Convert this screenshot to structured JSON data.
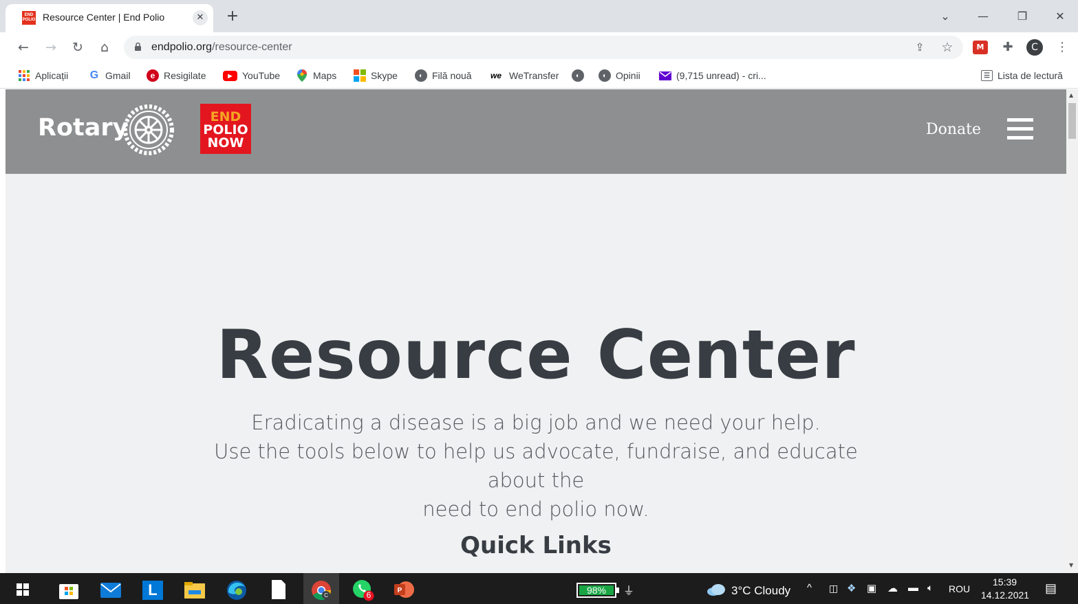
{
  "browser": {
    "tab_title": "Resource Center | End Polio",
    "tab_favicon_text": "END POLIO",
    "url_domain": "endpolio.org",
    "url_path": "/resource-center",
    "profile_initial": "C"
  },
  "bookmarks": [
    {
      "label": "Aplicații",
      "icon": "apps-grid-icon"
    },
    {
      "label": "Gmail",
      "icon": "google-icon"
    },
    {
      "label": "Resigilate",
      "icon": "emag-icon"
    },
    {
      "label": "YouTube",
      "icon": "youtube-icon"
    },
    {
      "label": "Maps",
      "icon": "maps-pin-icon"
    },
    {
      "label": "Skype",
      "icon": "windows-logo-icon"
    },
    {
      "label": "Filă nouă",
      "icon": "globe-icon"
    },
    {
      "label": "WeTransfer",
      "icon": "wetransfer-icon"
    },
    {
      "label": "",
      "icon": "globe-icon"
    },
    {
      "label": "Opinii",
      "icon": "globe-icon"
    },
    {
      "label": "(9,715 unread) - cri...",
      "icon": "mail-icon"
    }
  ],
  "reading_list": "Lista de lectură",
  "site": {
    "rotary_wordmark": "Rotary",
    "endpolio_logo": [
      "END",
      "POLIO",
      "NOW"
    ],
    "donate": "Donate",
    "hero_title": "Resource Center",
    "hero_subtitle_lines": [
      "Eradicating a disease is a big job and we need your help.",
      "Use the tools below to help us advocate, fundraise, and educate about the",
      "need to end polio now."
    ],
    "quick_links": "Quick Links"
  },
  "taskbar": {
    "battery": "98%",
    "weather": "3°C  Cloudy",
    "language": "ROU",
    "time": "15:39",
    "date": "14.12.2021",
    "whatsapp_badge": "6"
  },
  "colors": {
    "header_gray": "#8e8f90",
    "page_bg": "#f0f1f2",
    "endpolio_red": "#e3161f",
    "title_text": "#383d43"
  }
}
